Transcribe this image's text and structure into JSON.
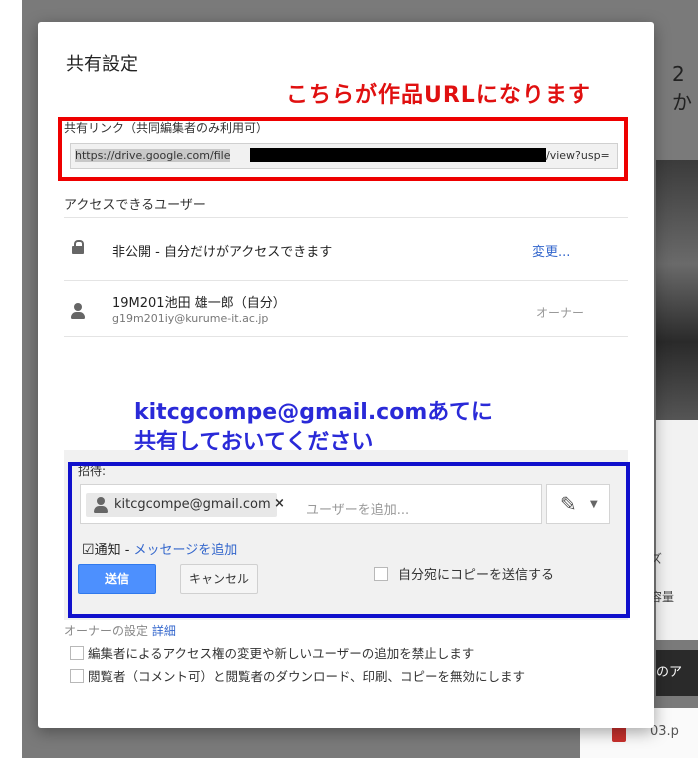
{
  "dialog": {
    "title": "共有設定",
    "annotation_url": "こちらが作品URLになります",
    "link": {
      "label": "共有リンク（共同編集者のみ利用可）",
      "url_prefix": "https://drive.google.com/file",
      "url_suffix": "/view?usp="
    },
    "access": {
      "label": "アクセスできるユーザー",
      "private_text": "非公開 - 自分だけがアクセスできます",
      "change_link": "変更...",
      "user_name": "19M201池田 雄一郎（自分）",
      "user_email": "g19m201iy@kurume-it.ac.jp",
      "role": "オーナー"
    },
    "annotation_share": [
      "kitcgcompe@gmail.comあてに",
      "共有しておいてください"
    ],
    "invite": {
      "label": "招待:",
      "chip_email": "kitcgcompe@gmail.com",
      "chip_remove": "×",
      "placeholder": "ユーザーを追加...",
      "notify_check": "☑",
      "notify_label": "通知 - ",
      "notify_message_link": "メッセージを追加",
      "send_button": "送信",
      "cancel_button": "キャンセル",
      "copy_to_self": "自分宛にコピーを送信する"
    },
    "owner_settings": {
      "label": "オーナーの設定",
      "detail_link": "詳細",
      "option1": "編集者によるアクセス権の変更や新しいユーザーの追加を禁止します",
      "option2": "閲覧者（コメント可）と閲覧者のダウンロード、印刷、コピーを無効にします"
    }
  },
  "background": {
    "right_text": [
      "2",
      "か"
    ],
    "right_labels": [
      "ズ",
      "容量"
    ],
    "dark_strip_text": "のア",
    "bottom_file": "03.p"
  },
  "colors": {
    "annotation_red": "#ee0000",
    "annotation_blue": "#1010cc",
    "primary_button": "#4d90fe",
    "link": "#3366cc"
  },
  "icons": [
    "lock-icon",
    "person-icon",
    "pen-icon",
    "chevron-down-icon"
  ]
}
